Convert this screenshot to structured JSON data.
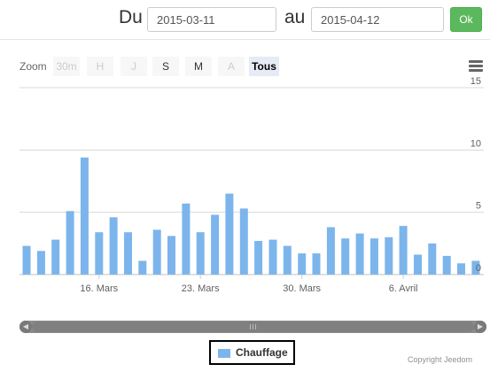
{
  "date_filter": {
    "from_label": "Du",
    "from_value": "2015-03-11",
    "to_label": "au",
    "to_value": "2015-04-12",
    "ok_label": "Ok",
    "ok_color": "#5cb85c"
  },
  "zoom": {
    "label": "Zoom",
    "buttons": [
      {
        "label": "30m",
        "state": "disabled"
      },
      {
        "label": "H",
        "state": "disabled"
      },
      {
        "label": "J",
        "state": "disabled"
      },
      {
        "label": "S",
        "state": "enabled"
      },
      {
        "label": "M",
        "state": "enabled"
      },
      {
        "label": "A",
        "state": "disabled"
      },
      {
        "label": "Tous",
        "state": "active"
      }
    ]
  },
  "menu_icon": "hamburger-menu-icon",
  "chart_data": {
    "type": "bar",
    "x_type": "date",
    "start_date": "2015-03-11",
    "x_tick_labels": [
      "16. Mars",
      "23. Mars",
      "30. Mars",
      "6. Avril"
    ],
    "y_tick_labels": [
      "0",
      "5",
      "10",
      "15"
    ],
    "ylim": [
      0,
      15
    ],
    "y_axis_side": "right",
    "grid": true,
    "legend_position": "bottom-center",
    "series": [
      {
        "name": "Chauffage",
        "color": "#7cb5ec",
        "values": [
          2.3,
          1.9,
          2.8,
          5.1,
          9.4,
          3.4,
          4.6,
          3.4,
          1.1,
          3.6,
          3.1,
          5.7,
          3.4,
          4.8,
          6.5,
          5.3,
          2.7,
          2.8,
          2.3,
          1.7,
          1.7,
          3.8,
          2.9,
          3.3,
          2.9,
          3.0,
          3.9,
          1.6,
          2.5,
          1.5,
          0.9,
          1.1
        ]
      }
    ]
  },
  "legend": {
    "label": "Chauffage",
    "color": "#7cb5ec"
  },
  "copyright": "Copyright Jeedom"
}
